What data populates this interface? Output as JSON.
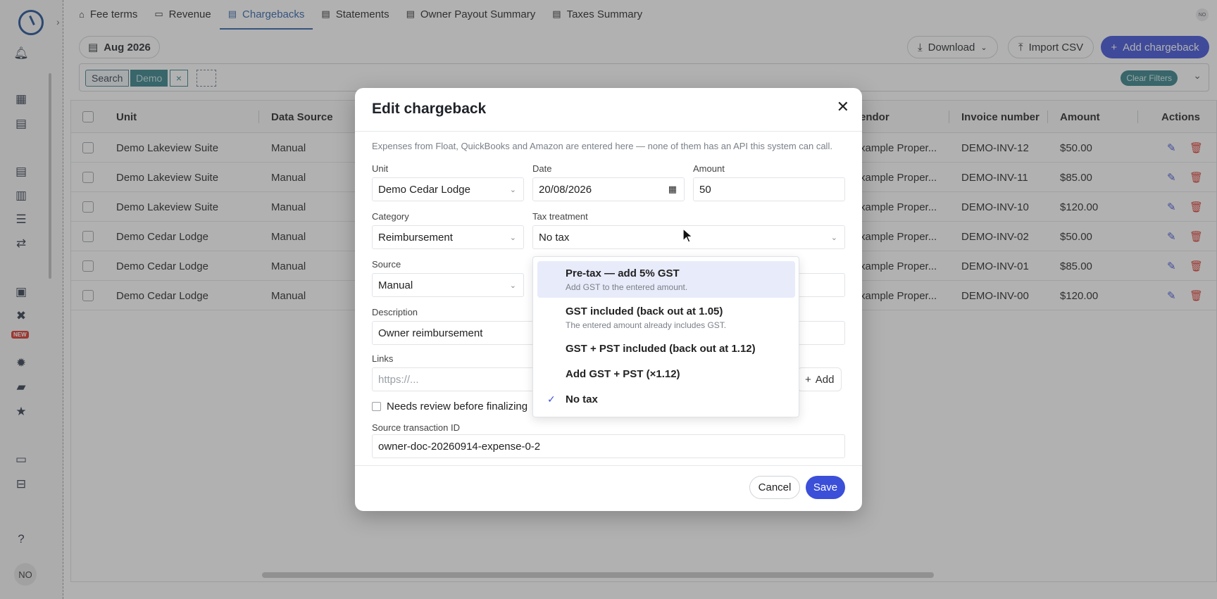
{
  "tabs": [
    {
      "label": "Fee terms",
      "icon": "house-icon"
    },
    {
      "label": "Revenue",
      "icon": "money-icon"
    },
    {
      "label": "Chargebacks",
      "icon": "document-icon"
    },
    {
      "label": "Statements",
      "icon": "document-icon"
    },
    {
      "label": "Owner Payout Summary",
      "icon": "document-icon"
    },
    {
      "label": "Taxes Summary",
      "icon": "document-icon"
    }
  ],
  "user_initials": "NO",
  "sidebar": {
    "new_badge": "NEW"
  },
  "toolbar": {
    "month": "Aug 2026",
    "download": "Download",
    "import_csv": "Import CSV",
    "add_chargeback": "Add chargeback"
  },
  "filters": {
    "search_label": "Search",
    "chip_value": "Demo",
    "remove": "×",
    "clear": "Clear Filters"
  },
  "table": {
    "headers": {
      "unit": "Unit",
      "data_source": "Data Source",
      "vendor": "endor",
      "invoice": "Invoice number",
      "amount": "Amount",
      "actions": "Actions"
    },
    "rows": [
      {
        "unit": "Demo Lakeview Suite",
        "source": "Manual",
        "vendor": "xample Proper...",
        "invoice": "DEMO-INV-12",
        "amount": "$50.00"
      },
      {
        "unit": "Demo Lakeview Suite",
        "source": "Manual",
        "vendor": "xample Proper...",
        "invoice": "DEMO-INV-11",
        "amount": "$85.00"
      },
      {
        "unit": "Demo Lakeview Suite",
        "source": "Manual",
        "vendor": "xample Proper...",
        "invoice": "DEMO-INV-10",
        "amount": "$120.00"
      },
      {
        "unit": "Demo Cedar Lodge",
        "source": "Manual",
        "vendor": "xample Proper...",
        "invoice": "DEMO-INV-02",
        "amount": "$50.00"
      },
      {
        "unit": "Demo Cedar Lodge",
        "source": "Manual",
        "vendor": "xample Proper...",
        "invoice": "DEMO-INV-01",
        "amount": "$85.00"
      },
      {
        "unit": "Demo Cedar Lodge",
        "source": "Manual",
        "vendor": "xample Proper...",
        "invoice": "DEMO-INV-00",
        "amount": "$120.00"
      }
    ]
  },
  "modal": {
    "title": "Edit chargeback",
    "close": "✕",
    "helper": "Expenses from Float, QuickBooks and Amazon are entered here — none of them has an API this system can call.",
    "unit_label": "Unit",
    "unit_value": "Demo Cedar Lodge",
    "date_label": "Date",
    "date_value": "20/08/2026",
    "amount_label": "Amount",
    "amount_value": "50",
    "category_label": "Category",
    "category_value": "Reimbursement",
    "tax_label": "Tax treatment",
    "tax_value": "No tax",
    "source_label": "Source",
    "source_value": "Manual",
    "description_label": "Description",
    "description_value": "Owner reimbursement",
    "links_label": "Links",
    "links_placeholder": "https://...",
    "add_link": "Add",
    "review_label": "Needs review before finalizing",
    "source_txn_label": "Source transaction ID",
    "source_txn_value": "owner-doc-20260914-expense-0-2",
    "cancel": "Cancel",
    "save": "Save"
  },
  "tax_dropdown": {
    "options": [
      {
        "title": "Pre-tax — add 5% GST",
        "desc": "Add GST to the entered amount."
      },
      {
        "title": "GST included (back out at 1.05)",
        "desc": "The entered amount already includes GST."
      },
      {
        "title": "GST + PST included (back out at 1.12)",
        "desc": ""
      },
      {
        "title": "Add GST + PST (×1.12)",
        "desc": ""
      },
      {
        "title": "No tax",
        "desc": ""
      }
    ],
    "selected": "No tax",
    "check": "✓"
  },
  "colors": {
    "primary": "#3b4fd8",
    "teal": "#2f7f86",
    "delete": "#d93025",
    "active_tab": "#2b5fa8"
  }
}
